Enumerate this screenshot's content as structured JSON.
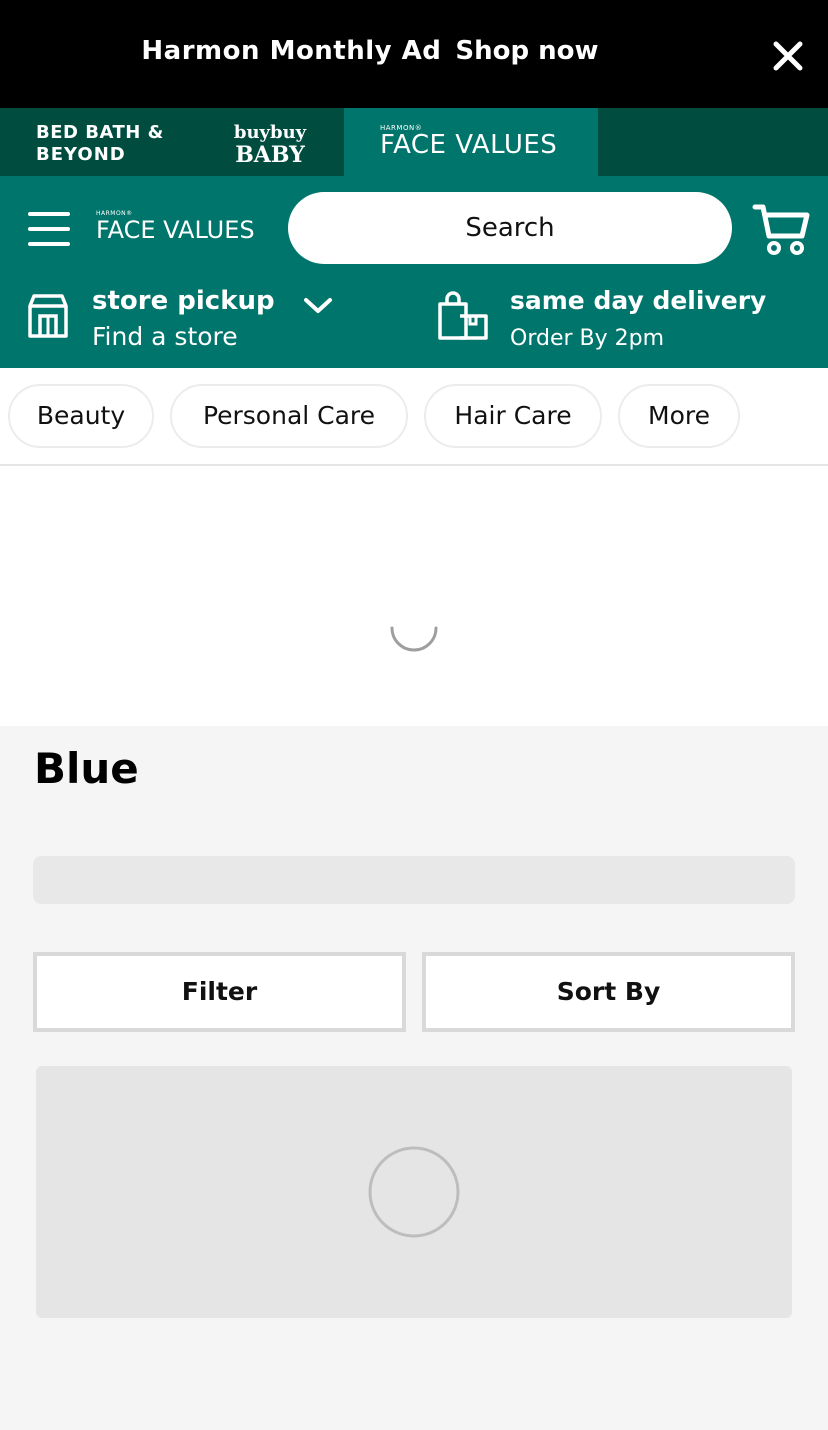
{
  "promo": {
    "title": "Harmon Monthly Ad",
    "link": "Shop now",
    "close_icon": "close-icon"
  },
  "brands": {
    "bbb_line1": "BED BATH &",
    "bbb_line2": "BEYOND",
    "baby_line1": "buybuy",
    "baby_line2": "BABY",
    "fv_small": "HARMON®",
    "fv_main": "FACE VALUES"
  },
  "header": {
    "logo_small": "HARMON®",
    "logo_main": "FACE VALUES",
    "search_placeholder": "Search",
    "pickup_title": "store pickup",
    "pickup_sub": "Find a store",
    "delivery_title": "same day delivery",
    "delivery_sub": "Order By 2pm"
  },
  "categories": [
    "Beauty",
    "Personal Care",
    "Hair Care",
    "More"
  ],
  "main": {
    "page_title": "Blue",
    "filter_label": "Filter",
    "sort_label": "Sort By"
  },
  "colors": {
    "brand_dark": "#004d40",
    "brand_teal": "#00756b",
    "promo_bg": "#000000"
  }
}
